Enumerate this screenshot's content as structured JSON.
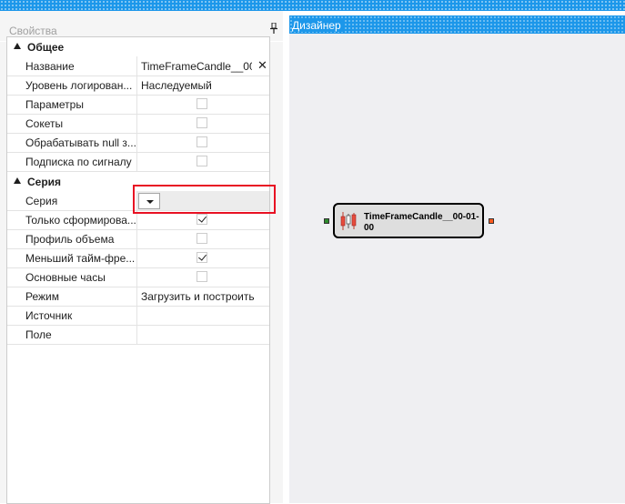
{
  "properties_panel": {
    "title": "Свойства",
    "pin_icon": "pin-icon",
    "categories": [
      {
        "label": "Общее",
        "rows": [
          {
            "name": "Название",
            "value": "TimeFrameCandle__00-",
            "type": "text-clearable"
          },
          {
            "name": "Уровень логирован...",
            "value": "Наследуемый",
            "type": "text"
          },
          {
            "name": "Параметры",
            "checked": false,
            "type": "checkbox"
          },
          {
            "name": "Сокеты",
            "checked": false,
            "type": "checkbox"
          },
          {
            "name": "Обрабатывать null з...",
            "checked": false,
            "type": "checkbox"
          },
          {
            "name": "Подписка по сигналу",
            "checked": false,
            "type": "checkbox"
          }
        ]
      },
      {
        "label": "Серия",
        "rows": [
          {
            "name": "Серия",
            "value": "",
            "type": "combo"
          },
          {
            "name": "Только сформирова...",
            "checked": true,
            "type": "checkbox"
          },
          {
            "name": "Профиль объема",
            "checked": false,
            "type": "checkbox"
          },
          {
            "name": "Меньший тайм-фре...",
            "checked": true,
            "type": "checkbox"
          },
          {
            "name": "Основные часы",
            "checked": false,
            "type": "checkbox"
          },
          {
            "name": "Режим",
            "value": "Загрузить и построить",
            "type": "text"
          },
          {
            "name": "Источник",
            "value": "",
            "type": "text"
          },
          {
            "name": "Поле",
            "value": "",
            "type": "text"
          }
        ]
      }
    ]
  },
  "designer": {
    "title": "Дизайнер",
    "node": {
      "label": "TimeFrameCandle__00-01-00",
      "icon": "candlestick-icon",
      "input_port_color": "#2e8b2e",
      "output_port_color": "#ff5a1f"
    }
  },
  "highlight_color": "#e81123",
  "accent_color": "#1c97ea"
}
